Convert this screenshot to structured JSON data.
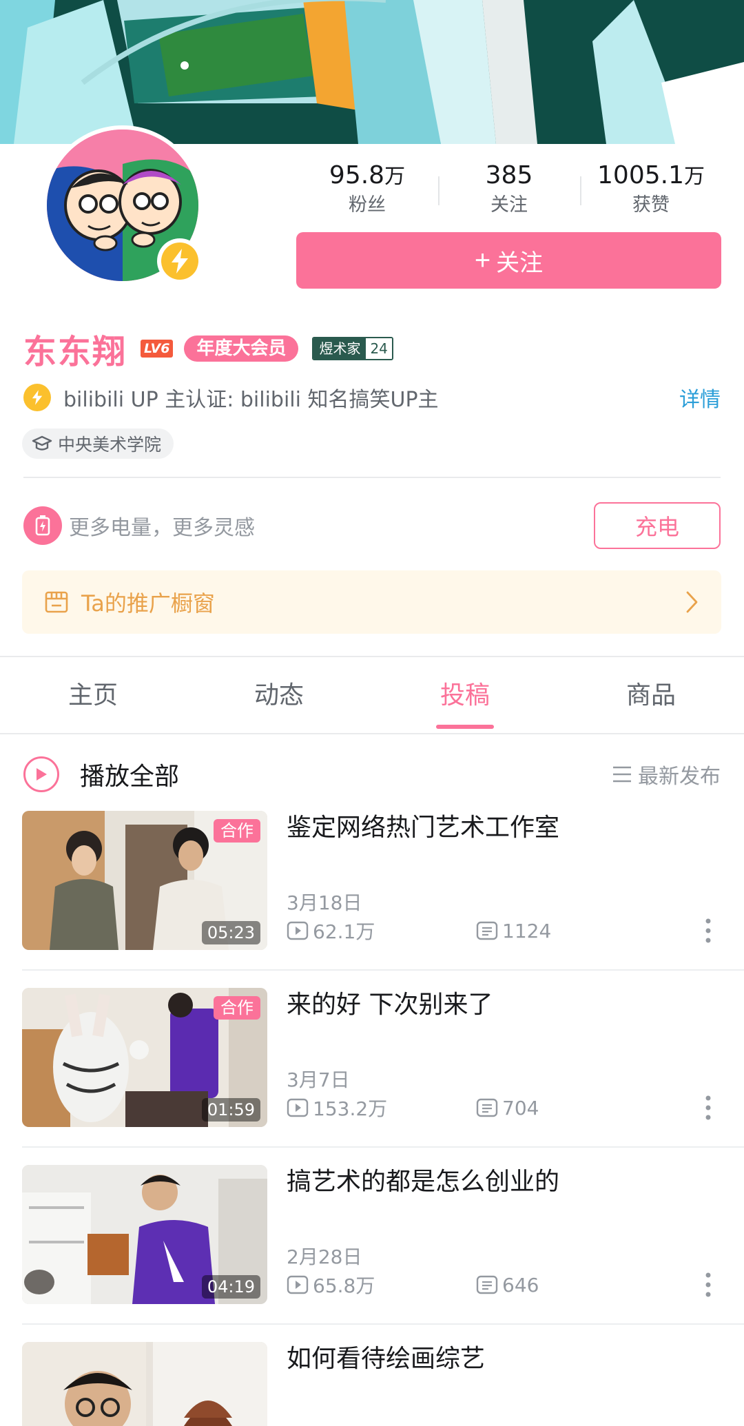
{
  "profile": {
    "name": "东东翔",
    "level": "LV6",
    "vip": "年度大会员",
    "medal_name": "煜术家",
    "medal_level": "24",
    "certification": "bilibili UP 主认证: bilibili 知名搞笑UP主",
    "cert_detail": "详情",
    "school": "中央美术学院"
  },
  "stats": [
    {
      "value": "95.8",
      "unit": "万",
      "label": "粉丝"
    },
    {
      "value": "385",
      "unit": "",
      "label": "关注"
    },
    {
      "value": "1005.1",
      "unit": "万",
      "label": "获赞"
    }
  ],
  "follow_button": {
    "plus": "+",
    "label": "关注"
  },
  "charge": {
    "text": "更多电量，更多灵感",
    "button": "充电"
  },
  "promo": {
    "text": "Ta的推广橱窗"
  },
  "tabs": [
    {
      "label": "主页",
      "active": false
    },
    {
      "label": "动态",
      "active": false
    },
    {
      "label": "投稿",
      "active": true
    },
    {
      "label": "商品",
      "active": false
    }
  ],
  "play_all": {
    "label": "播放全部",
    "sort": "最新发布"
  },
  "videos": [
    {
      "title": "鉴定网络热门艺术工作室",
      "date": "3月18日",
      "views": "62.1万",
      "comments": "1124",
      "duration": "05:23",
      "coop": "合作"
    },
    {
      "title": "来的好 下次别来了",
      "date": "3月7日",
      "views": "153.2万",
      "comments": "704",
      "duration": "01:59",
      "coop": "合作"
    },
    {
      "title": "搞艺术的都是怎么创业的",
      "date": "2月28日",
      "views": "65.8万",
      "comments": "646",
      "duration": "04:19",
      "coop": ""
    },
    {
      "title": "如何看待绘画综艺",
      "date": "",
      "views": "",
      "comments": "",
      "duration": "",
      "coop": ""
    }
  ],
  "colors": {
    "accent": "#fb7299",
    "link": "#2b9ed8",
    "gold": "#fbc02d",
    "promo_text": "#e9a24b"
  }
}
